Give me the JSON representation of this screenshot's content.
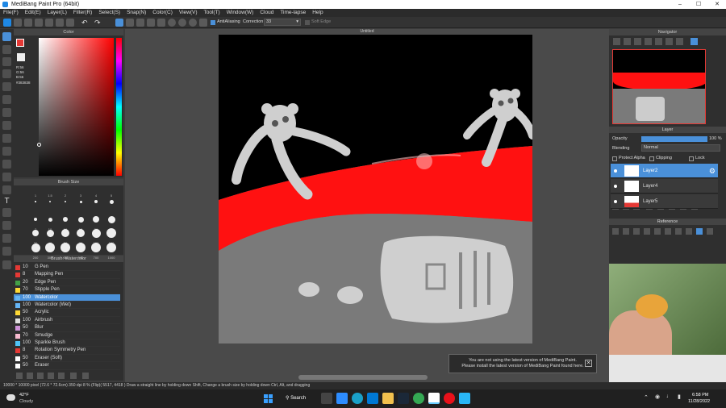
{
  "window": {
    "title": "MediBang Paint Pro (64bit)"
  },
  "menu": [
    "File(F)",
    "Edit(E)",
    "Layer(L)",
    "Filter(R)",
    "Select(S)",
    "Snap(N)",
    "Color(C)",
    "View(V)",
    "Tool(T)",
    "Window(W)",
    "Cloud",
    "Time-lapse",
    "Help"
  ],
  "toolbar": {
    "antialias": "AntiAliasing",
    "correction_label": "Correction",
    "correction_value": "33",
    "soft_edge": "Soft Edge"
  },
  "canvas_tab": "Untitled",
  "color_panel": {
    "title": "Color",
    "r": "R:56",
    "g": "G:56",
    "b": "B:56",
    "hex": "#383838"
  },
  "brush_size": {
    "title": "Brush Size",
    "labels": [
      "1",
      "1.5",
      "2",
      "3",
      "4",
      "5",
      "7",
      "10",
      "12",
      "15",
      "20",
      "25",
      "30",
      "40",
      "50",
      "70",
      "100",
      "150",
      "200",
      "300",
      "400",
      "500",
      "700",
      "1000"
    ]
  },
  "brush_panel": {
    "title": "Brush: Watercolor",
    "items": [
      {
        "size": "10",
        "name": "G Pen",
        "color": "#e53935"
      },
      {
        "size": "8",
        "name": "Mapping Pen",
        "color": "#e53935"
      },
      {
        "size": "20",
        "name": "Edge Pen",
        "color": "#43a047"
      },
      {
        "size": "70",
        "name": "Stipple Pen",
        "color": "#fdd835"
      },
      {
        "size": "100",
        "name": "Watercolor",
        "color": "#64b5f6"
      },
      {
        "size": "100",
        "name": "Watercolor (Wet)",
        "color": "#64b5f6"
      },
      {
        "size": "50",
        "name": "Acrylic",
        "color": "#fdd835"
      },
      {
        "size": "100",
        "name": "Airbrush",
        "color": "#e0e0e0"
      },
      {
        "size": "50",
        "name": "Blur",
        "color": "#ce93d8"
      },
      {
        "size": "70",
        "name": "Smudge",
        "color": "#f8bbd0"
      },
      {
        "size": "100",
        "name": "Sparkle Brush",
        "color": "#4fc3f7"
      },
      {
        "size": "8",
        "name": "Rotation Symmetry Pen",
        "color": "#e53935"
      },
      {
        "size": "50",
        "name": "Eraser (Soft)",
        "color": "#ffffff"
      },
      {
        "size": "50",
        "name": "Eraser",
        "color": "#ffffff"
      }
    ]
  },
  "navigator": {
    "title": "Navigator"
  },
  "layer_panel": {
    "title": "Layer",
    "opacity_label": "Opacity",
    "opacity_value": "100 %",
    "opacity": 1.0,
    "blending_label": "Blending",
    "blending_value": "Normal",
    "protect_alpha": "Protect Alpha",
    "clipping": "Clipping",
    "lock": "Lock",
    "layers": [
      {
        "name": "Layer2",
        "selected": true
      },
      {
        "name": "Layer4",
        "selected": false
      },
      {
        "name": "Layer5",
        "selected": false
      }
    ]
  },
  "reference": {
    "title": "Reference"
  },
  "notice": {
    "line1": "You are not using the latest version of MediBang Paint.",
    "line2": "Please install the latest version of MediBang Paint found here."
  },
  "status": {
    "text": "10000 * 10000 pixel   (72.6 * 72.6cm)   350 dpi   8 %   (Flip)( 5517, 4418 )   Draw a straight line by holding down Shift, Change a brush size by holding down Ctrl, Alt, and dragging"
  },
  "taskbar": {
    "temp": "42°F",
    "weather": "Cloudy",
    "search": "Search",
    "time": "6:58 PM",
    "date": "11/28/2022"
  }
}
